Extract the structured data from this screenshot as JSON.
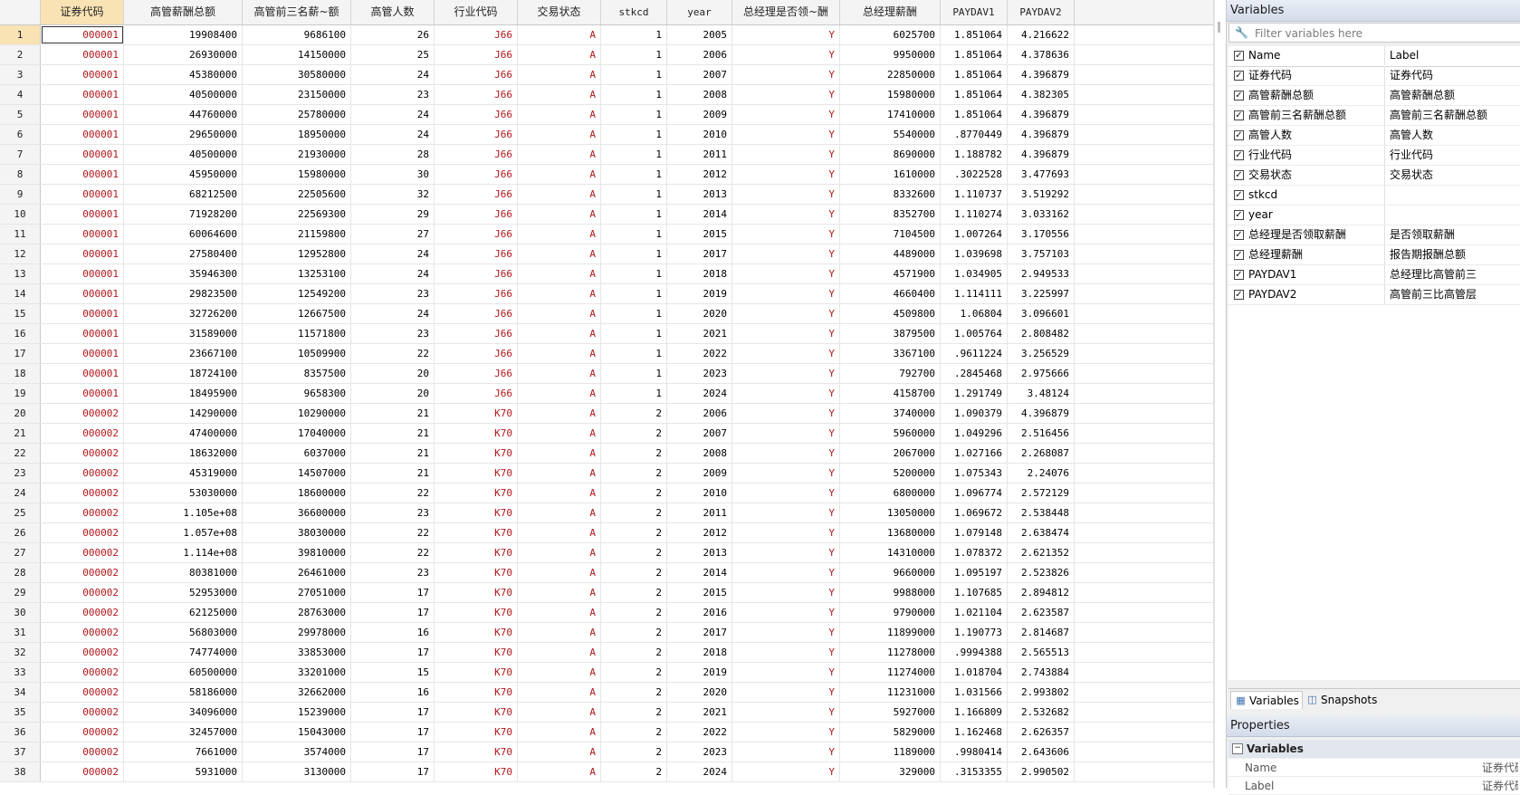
{
  "grid": {
    "columns": [
      {
        "id": "c0",
        "label": "证券代码",
        "selected": true
      },
      {
        "id": "c1",
        "label": "高管薪酬总额"
      },
      {
        "id": "c2",
        "label": "高管前三名薪~额"
      },
      {
        "id": "c3",
        "label": "高管人数"
      },
      {
        "id": "c4",
        "label": "行业代码"
      },
      {
        "id": "c5",
        "label": "交易状态"
      },
      {
        "id": "c6",
        "label": "stkcd"
      },
      {
        "id": "c7",
        "label": "year"
      },
      {
        "id": "c8",
        "label": "总经理是否领~酬"
      },
      {
        "id": "c9",
        "label": "总经理薪酬"
      },
      {
        "id": "c10",
        "label": "PAYDAV1"
      },
      {
        "id": "c11",
        "label": "PAYDAV2"
      }
    ],
    "rows": [
      [
        "1",
        "000001",
        "19908400",
        "9686100",
        "26",
        "J66",
        "A",
        "1",
        "2005",
        "Y",
        "6025700",
        "1.851064",
        "4.216622"
      ],
      [
        "2",
        "000001",
        "26930000",
        "14150000",
        "25",
        "J66",
        "A",
        "1",
        "2006",
        "Y",
        "9950000",
        "1.851064",
        "4.378636"
      ],
      [
        "3",
        "000001",
        "45380000",
        "30580000",
        "24",
        "J66",
        "A",
        "1",
        "2007",
        "Y",
        "22850000",
        "1.851064",
        "4.396879"
      ],
      [
        "4",
        "000001",
        "40500000",
        "23150000",
        "23",
        "J66",
        "A",
        "1",
        "2008",
        "Y",
        "15980000",
        "1.851064",
        "4.382305"
      ],
      [
        "5",
        "000001",
        "44760000",
        "25780000",
        "24",
        "J66",
        "A",
        "1",
        "2009",
        "Y",
        "17410000",
        "1.851064",
        "4.396879"
      ],
      [
        "6",
        "000001",
        "29650000",
        "18950000",
        "24",
        "J66",
        "A",
        "1",
        "2010",
        "Y",
        "5540000",
        ".8770449",
        "4.396879"
      ],
      [
        "7",
        "000001",
        "40500000",
        "21930000",
        "28",
        "J66",
        "A",
        "1",
        "2011",
        "Y",
        "8690000",
        "1.188782",
        "4.396879"
      ],
      [
        "8",
        "000001",
        "45950000",
        "15980000",
        "30",
        "J66",
        "A",
        "1",
        "2012",
        "Y",
        "1610000",
        ".3022528",
        "3.477693"
      ],
      [
        "9",
        "000001",
        "68212500",
        "22505600",
        "32",
        "J66",
        "A",
        "1",
        "2013",
        "Y",
        "8332600",
        "1.110737",
        "3.519292"
      ],
      [
        "10",
        "000001",
        "71928200",
        "22569300",
        "29",
        "J66",
        "A",
        "1",
        "2014",
        "Y",
        "8352700",
        "1.110274",
        "3.033162"
      ],
      [
        "11",
        "000001",
        "60064600",
        "21159800",
        "27",
        "J66",
        "A",
        "1",
        "2015",
        "Y",
        "7104500",
        "1.007264",
        "3.170556"
      ],
      [
        "12",
        "000001",
        "27580400",
        "12952800",
        "24",
        "J66",
        "A",
        "1",
        "2017",
        "Y",
        "4489000",
        "1.039698",
        "3.757103"
      ],
      [
        "13",
        "000001",
        "35946300",
        "13253100",
        "24",
        "J66",
        "A",
        "1",
        "2018",
        "Y",
        "4571900",
        "1.034905",
        "2.949533"
      ],
      [
        "14",
        "000001",
        "29823500",
        "12549200",
        "23",
        "J66",
        "A",
        "1",
        "2019",
        "Y",
        "4660400",
        "1.114111",
        "3.225997"
      ],
      [
        "15",
        "000001",
        "32726200",
        "12667500",
        "24",
        "J66",
        "A",
        "1",
        "2020",
        "Y",
        "4509800",
        "1.06804",
        "3.096601"
      ],
      [
        "16",
        "000001",
        "31589000",
        "11571800",
        "23",
        "J66",
        "A",
        "1",
        "2021",
        "Y",
        "3879500",
        "1.005764",
        "2.808482"
      ],
      [
        "17",
        "000001",
        "23667100",
        "10509900",
        "22",
        "J66",
        "A",
        "1",
        "2022",
        "Y",
        "3367100",
        ".9611224",
        "3.256529"
      ],
      [
        "18",
        "000001",
        "18724100",
        "8357500",
        "20",
        "J66",
        "A",
        "1",
        "2023",
        "Y",
        "792700",
        ".2845468",
        "2.975666"
      ],
      [
        "19",
        "000001",
        "18495900",
        "9658300",
        "20",
        "J66",
        "A",
        "1",
        "2024",
        "Y",
        "4158700",
        "1.291749",
        "3.48124"
      ],
      [
        "20",
        "000002",
        "14290000",
        "10290000",
        "21",
        "K70",
        "A",
        "2",
        "2006",
        "Y",
        "3740000",
        "1.090379",
        "4.396879"
      ],
      [
        "21",
        "000002",
        "47400000",
        "17040000",
        "21",
        "K70",
        "A",
        "2",
        "2007",
        "Y",
        "5960000",
        "1.049296",
        "2.516456"
      ],
      [
        "22",
        "000002",
        "18632000",
        "6037000",
        "21",
        "K70",
        "A",
        "2",
        "2008",
        "Y",
        "2067000",
        "1.027166",
        "2.268087"
      ],
      [
        "23",
        "000002",
        "45319000",
        "14507000",
        "21",
        "K70",
        "A",
        "2",
        "2009",
        "Y",
        "5200000",
        "1.075343",
        "2.24076"
      ],
      [
        "24",
        "000002",
        "53030000",
        "18600000",
        "22",
        "K70",
        "A",
        "2",
        "2010",
        "Y",
        "6800000",
        "1.096774",
        "2.572129"
      ],
      [
        "25",
        "000002",
        "1.105e+08",
        "36600000",
        "23",
        "K70",
        "A",
        "2",
        "2011",
        "Y",
        "13050000",
        "1.069672",
        "2.538448"
      ],
      [
        "26",
        "000002",
        "1.057e+08",
        "38030000",
        "22",
        "K70",
        "A",
        "2",
        "2012",
        "Y",
        "13680000",
        "1.079148",
        "2.638474"
      ],
      [
        "27",
        "000002",
        "1.114e+08",
        "39810000",
        "22",
        "K70",
        "A",
        "2",
        "2013",
        "Y",
        "14310000",
        "1.078372",
        "2.621352"
      ],
      [
        "28",
        "000002",
        "80381000",
        "26461000",
        "23",
        "K70",
        "A",
        "2",
        "2014",
        "Y",
        "9660000",
        "1.095197",
        "2.523826"
      ],
      [
        "29",
        "000002",
        "52953000",
        "27051000",
        "17",
        "K70",
        "A",
        "2",
        "2015",
        "Y",
        "9988000",
        "1.107685",
        "2.894812"
      ],
      [
        "30",
        "000002",
        "62125000",
        "28763000",
        "17",
        "K70",
        "A",
        "2",
        "2016",
        "Y",
        "9790000",
        "1.021104",
        "2.623587"
      ],
      [
        "31",
        "000002",
        "56803000",
        "29978000",
        "16",
        "K70",
        "A",
        "2",
        "2017",
        "Y",
        "11899000",
        "1.190773",
        "2.814687"
      ],
      [
        "32",
        "000002",
        "74774000",
        "33853000",
        "17",
        "K70",
        "A",
        "2",
        "2018",
        "Y",
        "11278000",
        ".9994388",
        "2.565513"
      ],
      [
        "33",
        "000002",
        "60500000",
        "33201000",
        "15",
        "K70",
        "A",
        "2",
        "2019",
        "Y",
        "11274000",
        "1.018704",
        "2.743884"
      ],
      [
        "34",
        "000002",
        "58186000",
        "32662000",
        "16",
        "K70",
        "A",
        "2",
        "2020",
        "Y",
        "11231000",
        "1.031566",
        "2.993802"
      ],
      [
        "35",
        "000002",
        "34096000",
        "15239000",
        "17",
        "K70",
        "A",
        "2",
        "2021",
        "Y",
        "5927000",
        "1.166809",
        "2.532682"
      ],
      [
        "36",
        "000002",
        "32457000",
        "15043000",
        "17",
        "K70",
        "A",
        "2",
        "2022",
        "Y",
        "5829000",
        "1.162468",
        "2.626357"
      ],
      [
        "37",
        "000002",
        "7661000",
        "3574000",
        "17",
        "K70",
        "A",
        "2",
        "2023",
        "Y",
        "1189000",
        ".9980414",
        "2.643606"
      ],
      [
        "38",
        "000002",
        "5931000",
        "3130000",
        "17",
        "K70",
        "A",
        "2",
        "2024",
        "Y",
        "329000",
        ".3153355",
        "2.990502"
      ]
    ]
  },
  "variables_panel": {
    "title": "Variables",
    "filter_placeholder": "Filter variables here",
    "col_name": "Name",
    "col_label": "Label",
    "vars": [
      {
        "name": "证券代码",
        "label": "证券代码"
      },
      {
        "name": "高管薪酬总额",
        "label": "高管薪酬总额"
      },
      {
        "name": "高管前三名薪酬总额",
        "label": "高管前三名薪酬总额"
      },
      {
        "name": "高管人数",
        "label": "高管人数"
      },
      {
        "name": "行业代码",
        "label": "行业代码"
      },
      {
        "name": "交易状态",
        "label": "交易状态"
      },
      {
        "name": "stkcd",
        "label": ""
      },
      {
        "name": "year",
        "label": ""
      },
      {
        "name": "总经理是否领取薪酬",
        "label": "是否领取薪酬"
      },
      {
        "name": "总经理薪酬",
        "label": "报告期报酬总额"
      },
      {
        "name": "PAYDAV1",
        "label": "总经理比高管前三"
      },
      {
        "name": "PAYDAV2",
        "label": "高管前三比高管层"
      }
    ],
    "tab_variables": "Variables",
    "tab_snapshots": "Snapshots"
  },
  "properties_panel": {
    "title": "Properties",
    "section": "Variables",
    "section_toggle": "−",
    "rows": [
      {
        "key": "Name",
        "value": "证券代码"
      },
      {
        "key": "Label",
        "value": "证券代码"
      }
    ]
  },
  "colors": {
    "string_red": "#b2171a",
    "selected_header": "#f9e3b4",
    "panel_title": "#d4dcea"
  }
}
